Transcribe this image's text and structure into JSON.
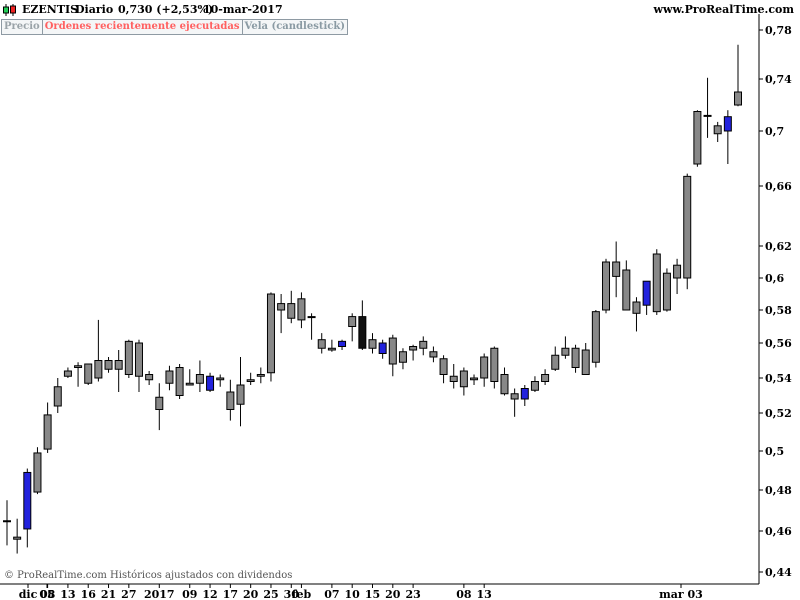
{
  "header": {
    "symbol": "EZENTIS",
    "period": "Diario",
    "quote": "0,730 (+2,53%)",
    "date": "10-mar-2017",
    "site": "www.ProRealTime.com",
    "icon": "candlestick-icon"
  },
  "tabs": [
    "Precio",
    "Ordenes recientemente ejecutadas",
    "Vela (candlestick)"
  ],
  "footer": "© ProRealTime.com  Históricos ajustados con dividendos",
  "colors": {
    "up": "#22cc55",
    "down": "#ee2222",
    "blue": "#2222dd",
    "black": "#111111"
  },
  "chart_data": {
    "type": "candlestick",
    "ylim": [
      0.44,
      0.78
    ],
    "y_ticks": [
      {
        "v": 0.44,
        "label": "0,44"
      },
      {
        "v": 0.46,
        "label": "0,46"
      },
      {
        "v": 0.48,
        "label": "0,48"
      },
      {
        "v": 0.5,
        "label": "0,5"
      },
      {
        "v": 0.52,
        "label": "0,52"
      },
      {
        "v": 0.54,
        "label": "0,54"
      },
      {
        "v": 0.56,
        "label": "0,56"
      },
      {
        "v": 0.58,
        "label": "0,58"
      },
      {
        "v": 0.6,
        "label": "0,6"
      },
      {
        "v": 0.62,
        "label": "0,62"
      },
      {
        "v": 0.66,
        "label": "0,66"
      },
      {
        "v": 0.7,
        "label": "0,7"
      },
      {
        "v": 0.74,
        "label": "0,74"
      },
      {
        "v": 0.78,
        "label": "0,78"
      }
    ],
    "x_labels": [
      {
        "i": 1,
        "label": "dic"
      },
      {
        "i": 2,
        "label": "05"
      },
      {
        "i": 4,
        "label": "08"
      },
      {
        "i": 6,
        "label": "13"
      },
      {
        "i": 8,
        "label": "16"
      },
      {
        "i": 10,
        "label": "21"
      },
      {
        "i": 12,
        "label": "27"
      },
      {
        "i": 15,
        "label": "2017"
      },
      {
        "i": 18,
        "label": "09"
      },
      {
        "i": 20,
        "label": "12"
      },
      {
        "i": 22,
        "label": "17"
      },
      {
        "i": 24,
        "label": "20"
      },
      {
        "i": 26,
        "label": "25"
      },
      {
        "i": 28,
        "label": "30"
      },
      {
        "i": 29,
        "label": "feb"
      },
      {
        "i": 32,
        "label": "07"
      },
      {
        "i": 34,
        "label": "10"
      },
      {
        "i": 36,
        "label": "15"
      },
      {
        "i": 38,
        "label": "20"
      },
      {
        "i": 40,
        "label": "23"
      },
      {
        "i": 43,
        "label": "mar 03"
      },
      {
        "i": 45,
        "label": "08"
      },
      {
        "i": 47,
        "label": "13"
      }
    ],
    "candles": [
      {
        "o": 0.465,
        "h": 0.475,
        "l": 0.453,
        "c": 0.465,
        "color": "black"
      },
      {
        "o": 0.457,
        "h": 0.466,
        "l": 0.449,
        "c": 0.456,
        "color": "red"
      },
      {
        "o": 0.461,
        "h": 0.491,
        "l": 0.452,
        "c": 0.489,
        "color": "blue"
      },
      {
        "o": 0.479,
        "h": 0.502,
        "l": 0.478,
        "c": 0.499,
        "color": "green"
      },
      {
        "o": 0.501,
        "h": 0.526,
        "l": 0.499,
        "c": 0.519,
        "color": "green"
      },
      {
        "o": 0.524,
        "h": 0.54,
        "l": 0.52,
        "c": 0.535,
        "color": "green"
      },
      {
        "o": 0.541,
        "h": 0.546,
        "l": 0.54,
        "c": 0.544,
        "color": "green"
      },
      {
        "o": 0.546,
        "h": 0.549,
        "l": 0.535,
        "c": 0.547,
        "color": "green"
      },
      {
        "o": 0.537,
        "h": 0.548,
        "l": 0.536,
        "c": 0.548,
        "color": "green"
      },
      {
        "o": 0.54,
        "h": 0.574,
        "l": 0.538,
        "c": 0.55,
        "color": "green"
      },
      {
        "o": 0.55,
        "h": 0.552,
        "l": 0.543,
        "c": 0.545,
        "color": "red"
      },
      {
        "o": 0.545,
        "h": 0.556,
        "l": 0.532,
        "c": 0.55,
        "color": "green"
      },
      {
        "o": 0.542,
        "h": 0.562,
        "l": 0.54,
        "c": 0.561,
        "color": "green"
      },
      {
        "o": 0.56,
        "h": 0.562,
        "l": 0.532,
        "c": 0.541,
        "color": "red"
      },
      {
        "o": 0.542,
        "h": 0.544,
        "l": 0.536,
        "c": 0.539,
        "color": "red"
      },
      {
        "o": 0.529,
        "h": 0.537,
        "l": 0.511,
        "c": 0.522,
        "color": "red"
      },
      {
        "o": 0.537,
        "h": 0.547,
        "l": 0.533,
        "c": 0.544,
        "color": "green"
      },
      {
        "o": 0.546,
        "h": 0.548,
        "l": 0.528,
        "c": 0.53,
        "color": "red"
      },
      {
        "o": 0.536,
        "h": 0.545,
        "l": 0.536,
        "c": 0.537,
        "color": "red"
      },
      {
        "o": 0.542,
        "h": 0.55,
        "l": 0.532,
        "c": 0.537,
        "color": "red"
      },
      {
        "o": 0.541,
        "h": 0.543,
        "l": 0.532,
        "c": 0.533,
        "color": "blue"
      },
      {
        "o": 0.54,
        "h": 0.542,
        "l": 0.535,
        "c": 0.539,
        "color": "red"
      },
      {
        "o": 0.532,
        "h": 0.539,
        "l": 0.516,
        "c": 0.522,
        "color": "red"
      },
      {
        "o": 0.525,
        "h": 0.552,
        "l": 0.513,
        "c": 0.536,
        "color": "green"
      },
      {
        "o": 0.539,
        "h": 0.543,
        "l": 0.536,
        "c": 0.538,
        "color": "red"
      },
      {
        "o": 0.541,
        "h": 0.546,
        "l": 0.537,
        "c": 0.542,
        "color": "green"
      },
      {
        "o": 0.543,
        "h": 0.591,
        "l": 0.538,
        "c": 0.59,
        "color": "green"
      },
      {
        "o": 0.584,
        "h": 0.59,
        "l": 0.566,
        "c": 0.58,
        "color": "red"
      },
      {
        "o": 0.575,
        "h": 0.592,
        "l": 0.572,
        "c": 0.584,
        "color": "green"
      },
      {
        "o": 0.587,
        "h": 0.591,
        "l": 0.569,
        "c": 0.574,
        "color": "red"
      },
      {
        "o": 0.576,
        "h": 0.578,
        "l": 0.562,
        "c": 0.576,
        "color": "black"
      },
      {
        "o": 0.562,
        "h": 0.566,
        "l": 0.554,
        "c": 0.557,
        "color": "red"
      },
      {
        "o": 0.557,
        "h": 0.562,
        "l": 0.555,
        "c": 0.556,
        "color": "red"
      },
      {
        "o": 0.561,
        "h": 0.562,
        "l": 0.556,
        "c": 0.558,
        "color": "blue"
      },
      {
        "o": 0.57,
        "h": 0.578,
        "l": 0.561,
        "c": 0.576,
        "color": "green"
      },
      {
        "o": 0.557,
        "h": 0.586,
        "l": 0.556,
        "c": 0.576,
        "color": "black"
      },
      {
        "o": 0.562,
        "h": 0.566,
        "l": 0.554,
        "c": 0.557,
        "color": "red"
      },
      {
        "o": 0.56,
        "h": 0.562,
        "l": 0.551,
        "c": 0.554,
        "color": "blue"
      },
      {
        "o": 0.563,
        "h": 0.565,
        "l": 0.541,
        "c": 0.548,
        "color": "red"
      },
      {
        "o": 0.549,
        "h": 0.557,
        "l": 0.545,
        "c": 0.555,
        "color": "green"
      },
      {
        "o": 0.556,
        "h": 0.559,
        "l": 0.55,
        "c": 0.558,
        "color": "red"
      },
      {
        "o": 0.561,
        "h": 0.564,
        "l": 0.553,
        "c": 0.557,
        "color": "red"
      },
      {
        "o": 0.555,
        "h": 0.558,
        "l": 0.549,
        "c": 0.552,
        "color": "red"
      },
      {
        "o": 0.551,
        "h": 0.553,
        "l": 0.537,
        "c": 0.542,
        "color": "red"
      },
      {
        "o": 0.541,
        "h": 0.548,
        "l": 0.534,
        "c": 0.538,
        "color": "red"
      },
      {
        "o": 0.544,
        "h": 0.546,
        "l": 0.53,
        "c": 0.535,
        "color": "red"
      },
      {
        "o": 0.54,
        "h": 0.542,
        "l": 0.536,
        "c": 0.539,
        "color": "red"
      },
      {
        "o": 0.54,
        "h": 0.554,
        "l": 0.535,
        "c": 0.552,
        "color": "green"
      },
      {
        "o": 0.557,
        "h": 0.558,
        "l": 0.534,
        "c": 0.538,
        "color": "red"
      },
      {
        "o": 0.542,
        "h": 0.546,
        "l": 0.53,
        "c": 0.531,
        "color": "red"
      },
      {
        "o": 0.531,
        "h": 0.534,
        "l": 0.518,
        "c": 0.528,
        "color": "red"
      },
      {
        "o": 0.528,
        "h": 0.536,
        "l": 0.524,
        "c": 0.534,
        "color": "blue"
      },
      {
        "o": 0.533,
        "h": 0.541,
        "l": 0.532,
        "c": 0.538,
        "color": "green"
      },
      {
        "o": 0.538,
        "h": 0.545,
        "l": 0.536,
        "c": 0.542,
        "color": "green"
      },
      {
        "o": 0.545,
        "h": 0.558,
        "l": 0.544,
        "c": 0.553,
        "color": "green"
      },
      {
        "o": 0.553,
        "h": 0.564,
        "l": 0.551,
        "c": 0.557,
        "color": "red"
      },
      {
        "o": 0.557,
        "h": 0.559,
        "l": 0.543,
        "c": 0.546,
        "color": "red"
      },
      {
        "o": 0.556,
        "h": 0.56,
        "l": 0.542,
        "c": 0.542,
        "color": "red"
      },
      {
        "o": 0.549,
        "h": 0.58,
        "l": 0.546,
        "c": 0.579,
        "color": "green"
      },
      {
        "o": 0.58,
        "h": 0.612,
        "l": 0.578,
        "c": 0.61,
        "color": "green"
      },
      {
        "o": 0.61,
        "h": 0.623,
        "l": 0.588,
        "c": 0.601,
        "color": "red"
      },
      {
        "o": 0.605,
        "h": 0.611,
        "l": 0.58,
        "c": 0.58,
        "color": "red"
      },
      {
        "o": 0.585,
        "h": 0.588,
        "l": 0.567,
        "c": 0.578,
        "color": "red"
      },
      {
        "o": 0.583,
        "h": 0.598,
        "l": 0.577,
        "c": 0.598,
        "color": "blue"
      },
      {
        "o": 0.615,
        "h": 0.618,
        "l": 0.577,
        "c": 0.579,
        "color": "red"
      },
      {
        "o": 0.58,
        "h": 0.606,
        "l": 0.579,
        "c": 0.603,
        "color": "green"
      },
      {
        "o": 0.608,
        "h": 0.612,
        "l": 0.59,
        "c": 0.6,
        "color": "red"
      },
      {
        "o": 0.6,
        "h": 0.669,
        "l": 0.593,
        "c": 0.667,
        "color": "green"
      },
      {
        "o": 0.676,
        "h": 0.716,
        "l": 0.674,
        "c": 0.715,
        "color": "green"
      },
      {
        "o": 0.712,
        "h": 0.741,
        "l": 0.695,
        "c": 0.712,
        "color": "black"
      },
      {
        "o": 0.704,
        "h": 0.707,
        "l": 0.692,
        "c": 0.698,
        "color": "red"
      },
      {
        "o": 0.7,
        "h": 0.716,
        "l": 0.676,
        "c": 0.711,
        "color": "blue"
      },
      {
        "o": 0.72,
        "h": 0.768,
        "l": 0.719,
        "c": 0.73,
        "color": "green"
      }
    ]
  }
}
